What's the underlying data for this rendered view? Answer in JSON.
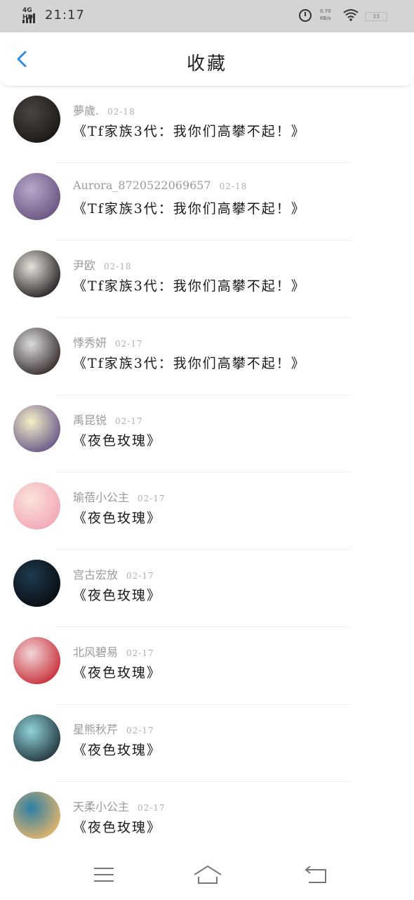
{
  "status_bar": {
    "network": "4G HD",
    "time": "21:17",
    "speed_value": "0.70",
    "speed_unit": "KB/s",
    "battery": "33"
  },
  "header": {
    "title": "收藏",
    "back_icon": "chevron-left-icon",
    "accent_color": "#2f8de4"
  },
  "items": [
    {
      "name": "夢歲.",
      "date": "02-18",
      "title": "《Tf家族3代：我你们高攀不起！》",
      "avatar_colors": [
        "#4a4540",
        "#1b1917"
      ]
    },
    {
      "name": "Aurora_8720522069657",
      "date": "02-18",
      "title": "《Tf家族3代：我你们高攀不起！》",
      "avatar_colors": [
        "#b9a7c9",
        "#6a5683"
      ]
    },
    {
      "name": "尹欧",
      "date": "02-18",
      "title": "《Tf家族3代：我你们高攀不起！》",
      "avatar_colors": [
        "#e8e2dc",
        "#2a2626"
      ]
    },
    {
      "name": "悸秀妍",
      "date": "02-17",
      "title": "《Tf家族3代：我你们高攀不起！》",
      "avatar_colors": [
        "#dcdcdc",
        "#3a2f2f"
      ]
    },
    {
      "name": "禹昆锐",
      "date": "02-17",
      "title": "《夜色玫瑰》",
      "avatar_colors": [
        "#f6f0c8",
        "#6b5a8a"
      ]
    },
    {
      "name": "瑜蓓小公主",
      "date": "02-17",
      "title": "《夜色玫瑰》",
      "avatar_colors": [
        "#fbe3da",
        "#f2a8b8"
      ]
    },
    {
      "name": "宫古宏放",
      "date": "02-17",
      "title": "《夜色玫瑰》",
      "avatar_colors": [
        "#1e3b4e",
        "#090d12"
      ]
    },
    {
      "name": "北风碧易",
      "date": "02-17",
      "title": "《夜色玫瑰》",
      "avatar_colors": [
        "#f3d6d8",
        "#c8323d"
      ]
    },
    {
      "name": "星熊秋芹",
      "date": "02-17",
      "title": "《夜色玫瑰》",
      "avatar_colors": [
        "#8fd3d8",
        "#263840"
      ]
    },
    {
      "name": "天柔小公主",
      "date": "02-17",
      "title": "《夜色玫瑰》",
      "avatar_colors": [
        "#2c7fa6",
        "#e2b46a"
      ]
    }
  ],
  "nav": {
    "menu_icon": "menu-icon",
    "home_icon": "home-icon",
    "back_icon": "back-arrow-icon"
  }
}
